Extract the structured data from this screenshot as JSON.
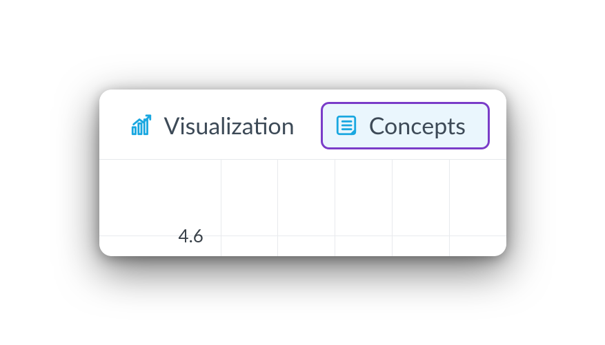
{
  "tabs": {
    "visualization": {
      "label": "Visualization",
      "icon": "chart-growth-icon"
    },
    "concepts": {
      "label": "Concepts",
      "icon": "list-note-icon",
      "selected": true
    }
  },
  "chart_data": {
    "type": "bar",
    "categories": [],
    "values": [],
    "title": "",
    "xlabel": "",
    "ylabel": "",
    "y_ticks_visible": [
      4.6
    ],
    "ylim": [
      4.6,
      null
    ],
    "grid_columns_visible": 6
  },
  "colors": {
    "accent_icon": "#19a7e0",
    "selected_border": "#7a3cc8",
    "selected_bg": "#eaf6fd",
    "text": "#3d4a57"
  }
}
